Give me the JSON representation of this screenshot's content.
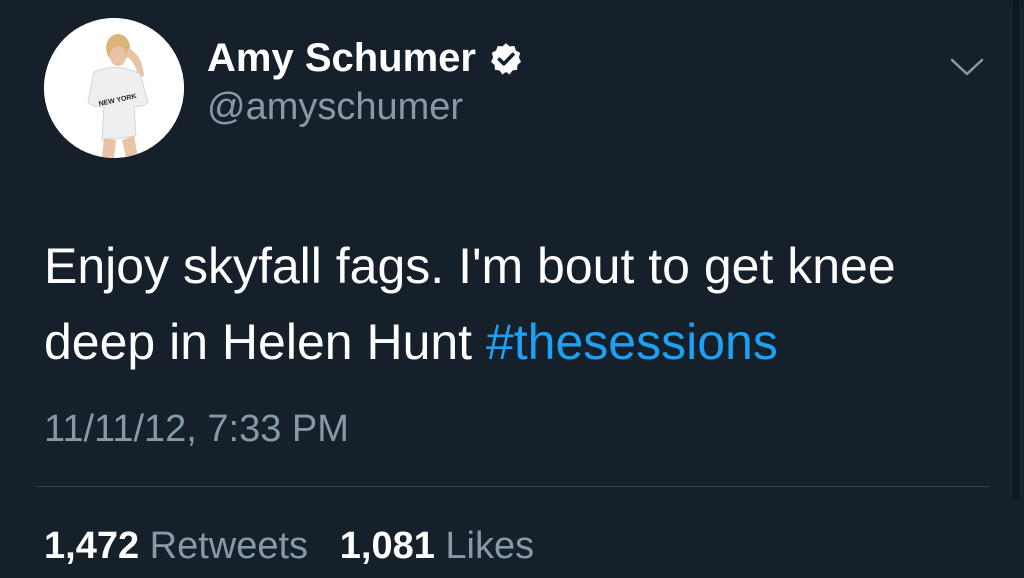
{
  "author": {
    "display_name": "Amy Schumer",
    "handle": "@amyschumer",
    "verified": true,
    "avatar_shirt_text": "NEW YORK"
  },
  "tweet": {
    "text_plain": "Enjoy skyfall fags. I'm bout to get knee deep in Helen Hunt",
    "hashtag": "#thesessions",
    "timestamp": "11/11/12, 7:33 PM"
  },
  "stats": {
    "retweets_count": "1,472",
    "retweets_label": "Retweets",
    "likes_count": "1,081",
    "likes_label": "Likes"
  },
  "icons": {
    "verified": "verified-badge-icon",
    "menu": "chevron-down-icon"
  },
  "colors": {
    "background": "#15202b",
    "link": "#1da1f2",
    "secondary_text": "#8899a6",
    "primary_text": "#ffffff"
  }
}
